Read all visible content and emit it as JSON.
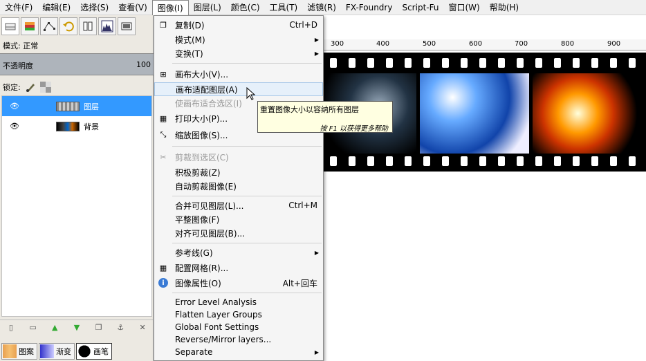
{
  "menubar": {
    "items": [
      "文件(F)",
      "编辑(E)",
      "选择(S)",
      "查看(V)",
      "图像(I)",
      "图层(L)",
      "颜色(C)",
      "工具(T)",
      "滤镜(R)",
      "FX-Foundry",
      "Script-Fu",
      "窗口(W)",
      "帮助(H)"
    ]
  },
  "dock": {
    "mode_label": "模式: 正常",
    "opacity_label": "不透明度",
    "opacity_value": "100",
    "lock_label": "锁定:",
    "layers": [
      {
        "name": "图层"
      },
      {
        "name": "背景"
      }
    ],
    "brush_tabs": [
      "图案",
      "渐变",
      "画笔"
    ]
  },
  "ruler": {
    "ticks": [
      "300",
      "400",
      "500",
      "600",
      "700",
      "800",
      "900"
    ]
  },
  "image_menu": {
    "items": [
      {
        "label": "复制(D)",
        "shortcut": "Ctrl+D",
        "icon": "duplicate-icon"
      },
      {
        "label": "模式(M)",
        "submenu": true
      },
      {
        "label": "变换(T)",
        "submenu": true
      },
      {
        "label": "画布大小(V)...",
        "icon": "canvas-size-icon"
      },
      {
        "label": "画布适配图层(A)",
        "hover": true
      },
      {
        "label": "使画布适合选区(I)",
        "disabled": true
      },
      {
        "label": "打印大小(P)...",
        "icon": "print-size-icon"
      },
      {
        "label": "缩放图像(S)...",
        "icon": "scale-image-icon"
      },
      {
        "label": "剪裁到选区(C)",
        "disabled": true,
        "icon": "crop-icon"
      },
      {
        "label": "积极剪裁(Z)"
      },
      {
        "label": "自动剪裁图像(E)"
      },
      {
        "label": "合并可见图层(L)...",
        "shortcut": "Ctrl+M"
      },
      {
        "label": "平整图像(F)"
      },
      {
        "label": "对齐可见图层(B)..."
      },
      {
        "label": "参考线(G)",
        "submenu": true
      },
      {
        "label": "配置网格(R)...",
        "icon": "grid-icon"
      },
      {
        "label": "图像属性(O)",
        "shortcut": "Alt+回车",
        "icon": "info-icon"
      },
      {
        "label": "Error Level Analysis"
      },
      {
        "label": "Flatten Layer Groups"
      },
      {
        "label": "Global Font Settings"
      },
      {
        "label": "Reverse/Mirror layers..."
      },
      {
        "label": "Separate",
        "submenu": true
      }
    ]
  },
  "tooltip": {
    "text": "重置图像大小以容纳所有图层",
    "hint": "按 F1 以获得更多帮助"
  }
}
